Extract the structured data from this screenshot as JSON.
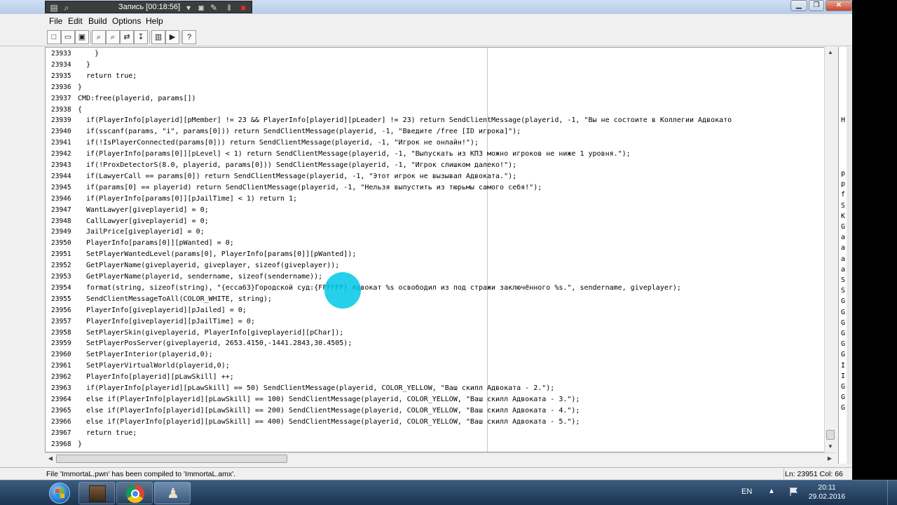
{
  "recorder": {
    "title": "Запись [00:18:56]"
  },
  "menu": [
    "File",
    "Edit",
    "Build",
    "Options",
    "Help"
  ],
  "toolbar": {
    "icons": [
      "new-file-icon",
      "open-file-icon",
      "save-icon",
      "find-icon",
      "find-next-icon",
      "replace-icon",
      "goto-line-icon",
      "compile-icon",
      "run-icon",
      "help-icon"
    ]
  },
  "editor": {
    "lines": [
      {
        "n": "23933",
        "t": "    }"
      },
      {
        "n": "23934",
        "t": "  }"
      },
      {
        "n": "23935",
        "t": "  return true;"
      },
      {
        "n": "23936",
        "t": "}"
      },
      {
        "n": "23937",
        "t": "CMD:free(playerid, params[])"
      },
      {
        "n": "23938",
        "t": "{"
      },
      {
        "n": "23939",
        "t": "  if(PlayerInfo[playerid][pMember] != 23 && PlayerInfo[playerid][pLeader] != 23) return SendClientMessage(playerid, -1, \"Вы не состоите в Коллегии Адвокато"
      },
      {
        "n": "23940",
        "t": "  if(sscanf(params, \"i\", params[0])) return SendClientMessage(playerid, -1, \"Введите /free [ID игрока]\");"
      },
      {
        "n": "23941",
        "t": "  if(!IsPlayerConnected(params[0])) return SendClientMessage(playerid, -1, \"Игрок не онлайн!\");"
      },
      {
        "n": "23942",
        "t": "  if(PlayerInfo[params[0]][pLevel] < 1) return SendClientMessage(playerid, -1, \"Выпускать из КПЗ можно игроков не ниже 1 уровня.\");"
      },
      {
        "n": "23943",
        "t": "  if(!ProxDetectorS(8.0, playerid, params[0])) SendClientMessage(playerid, -1, \"Игрок слишком далеко!\");"
      },
      {
        "n": "23944",
        "t": "  if(LawyerCall == params[0]) return SendClientMessage(playerid, -1, \"Этот игрок не вызывал Адвоката.\");"
      },
      {
        "n": "23945",
        "t": "  if(params[0] == playerid) return SendClientMessage(playerid, -1, \"Нельзя выпустить из тюрьмы самого себя!\");"
      },
      {
        "n": "23946",
        "t": "  if(PlayerInfo[params[0]][pJailTime] < 1) return 1;"
      },
      {
        "n": "23947",
        "t": "  WantLawyer[giveplayerid] = 0;"
      },
      {
        "n": "23948",
        "t": "  CallLawyer[giveplayerid] = 0;"
      },
      {
        "n": "23949",
        "t": "  JailPrice[giveplayerid] = 0;"
      },
      {
        "n": "23950",
        "t": "  PlayerInfo[params[0]][pWanted] = 0;"
      },
      {
        "n": "23951",
        "t": "  SetPlayerWantedLevel(params[0], PlayerInfo[params[0]][pWanted]);"
      },
      {
        "n": "23952",
        "t": "  GetPlayerName(giveplayerid, giveplayer, sizeof(giveplayer));"
      },
      {
        "n": "23953",
        "t": "  GetPlayerName(playerid, sendername, sizeof(sendername));"
      },
      {
        "n": "23954",
        "t": "  format(string, sizeof(string), \"{ecca63}Городской суд:{FFFFFF} Адвокат %s освободил из под стражи заключённого %s.\", sendername, giveplayer);"
      },
      {
        "n": "23955",
        "t": "  SendClientMessageToAll(COLOR_WHITE, string);"
      },
      {
        "n": "23956",
        "t": "  PlayerInfo[giveplayerid][pJailed] = 0;"
      },
      {
        "n": "23957",
        "t": "  PlayerInfo[giveplayerid][pJailTime] = 0;"
      },
      {
        "n": "23958",
        "t": "  SetPlayerSkin(giveplayerid, PlayerInfo[giveplayerid][pChar]);"
      },
      {
        "n": "23959",
        "t": "  SetPlayerPosServer(giveplayerid, 2653.4150,-1441.2843,30.4505);"
      },
      {
        "n": "23960",
        "t": "  SetPlayerInterior(playerid,0);"
      },
      {
        "n": "23961",
        "t": "  SetPlayerVirtualWorld(playerid,0);"
      },
      {
        "n": "23962",
        "t": "  PlayerInfo[playerid][pLawSkill] ++;"
      },
      {
        "n": "23963",
        "t": "  if(PlayerInfo[playerid][pLawSkill] == 50) SendClientMessage(playerid, COLOR_YELLOW, \"Ваш скилл Адвоката - 2.\");"
      },
      {
        "n": "23964",
        "t": "  else if(PlayerInfo[playerid][pLawSkill] == 100) SendClientMessage(playerid, COLOR_YELLOW, \"Ваш скилл Адвоката - 3.\");"
      },
      {
        "n": "23965",
        "t": "  else if(PlayerInfo[playerid][pLawSkill] == 200) SendClientMessage(playerid, COLOR_YELLOW, \"Ваш скилл Адвоката - 4.\");"
      },
      {
        "n": "23966",
        "t": "  else if(PlayerInfo[playerid][pLawSkill] == 400) SendClientMessage(playerid, COLOR_YELLOW, \"Ваш скилл Адвоката - 5.\");"
      },
      {
        "n": "23967",
        "t": "  return true;"
      },
      {
        "n": "23968",
        "t": "}"
      }
    ]
  },
  "side_panel": {
    "letters": [
      "H",
      "p",
      "p",
      "f",
      "S",
      "K",
      "G",
      "a",
      "a",
      "a",
      "a",
      "S",
      "S",
      "G",
      "G",
      "G",
      "G",
      "G",
      "G",
      "I",
      "I",
      "G",
      "G",
      "G"
    ]
  },
  "status": {
    "message": "File 'ImmortaL.pwn' has been compiled to 'ImmortaL.amx'.",
    "position": "Ln: 23951   Col: 66"
  },
  "taskbar": {
    "language": "EN",
    "time": "20:11",
    "date": "29.02.2016",
    "apps": [
      "game-app-icon",
      "chrome-icon",
      "pawno-icon"
    ]
  },
  "colors": {
    "keyword": "#0000c0",
    "string": "#000080",
    "cursor_highlight": "#00c8e6"
  }
}
